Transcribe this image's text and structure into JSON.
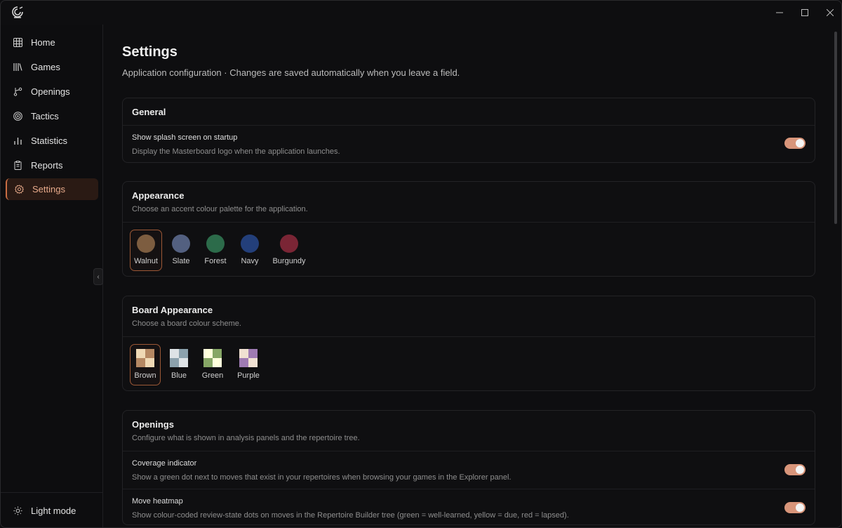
{
  "window": {
    "controls": [
      "minimize",
      "maximize",
      "close"
    ]
  },
  "sidebar": {
    "items": [
      {
        "label": "Home",
        "icon": "grid-icon",
        "active": false
      },
      {
        "label": "Games",
        "icon": "library-icon",
        "active": false
      },
      {
        "label": "Openings",
        "icon": "branch-icon",
        "active": false
      },
      {
        "label": "Tactics",
        "icon": "target-icon",
        "active": false
      },
      {
        "label": "Statistics",
        "icon": "bar-chart-icon",
        "active": false
      },
      {
        "label": "Reports",
        "icon": "clipboard-icon",
        "active": false
      },
      {
        "label": "Settings",
        "icon": "gear-icon",
        "active": true
      }
    ],
    "light_mode_label": "Light mode",
    "collapse_glyph": "‹"
  },
  "page": {
    "title": "Settings",
    "subtitle": "Application configuration · Changes are saved automatically when you leave a field."
  },
  "general": {
    "title": "General",
    "splash": {
      "title": "Show splash screen on startup",
      "desc": "Display the Masterboard logo when the application launches.",
      "enabled": true
    }
  },
  "appearance": {
    "title": "Appearance",
    "desc": "Choose an accent colour palette for the application.",
    "palettes": [
      {
        "label": "Walnut",
        "color": "#7d5d40",
        "selected": true
      },
      {
        "label": "Slate",
        "color": "#536080",
        "selected": false
      },
      {
        "label": "Forest",
        "color": "#2c6b4a",
        "selected": false
      },
      {
        "label": "Navy",
        "color": "#233f7a",
        "selected": false
      },
      {
        "label": "Burgundy",
        "color": "#7a2535",
        "selected": false
      }
    ]
  },
  "board_appearance": {
    "title": "Board Appearance",
    "desc": "Choose a board colour scheme.",
    "schemes": [
      {
        "label": "Brown",
        "light": "#f0d9b5",
        "dark": "#b58863",
        "selected": true
      },
      {
        "label": "Blue",
        "light": "#dee3e6",
        "dark": "#8ca2ad",
        "selected": false
      },
      {
        "label": "Green",
        "light": "#ffffdd",
        "dark": "#86a666",
        "selected": false
      },
      {
        "label": "Purple",
        "light": "#f0e1d2",
        "dark": "#9f7bb3",
        "selected": false
      }
    ]
  },
  "openings": {
    "title": "Openings",
    "desc": "Configure what is shown in analysis panels and the repertoire tree.",
    "coverage": {
      "title": "Coverage indicator",
      "desc": "Show a green dot next to moves that exist in your repertoires when browsing your games in the Explorer panel.",
      "enabled": true
    },
    "heatmap": {
      "title": "Move heatmap",
      "desc": "Show colour-coded review-state dots on moves in the Repertoire Builder tree (green = well-learned, yellow = due, red = lapsed).",
      "enabled": true
    }
  },
  "colors": {
    "accent": "#c96d43",
    "toggle_on": "#d8957a"
  }
}
